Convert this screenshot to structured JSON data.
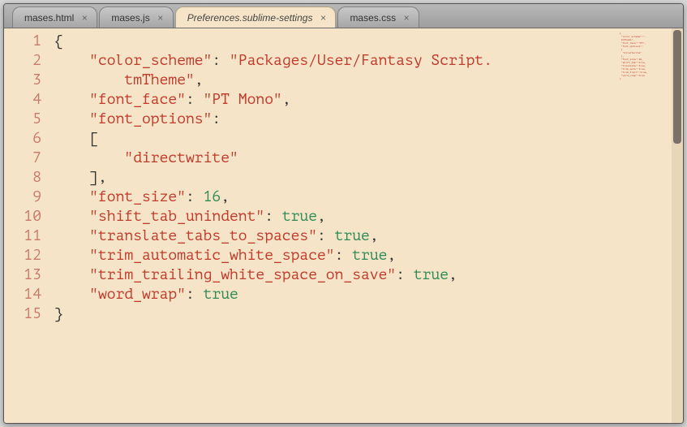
{
  "tabs": [
    {
      "label": "mases.html",
      "active": false
    },
    {
      "label": "mases.js",
      "active": false
    },
    {
      "label": "Preferences.sublime-settings",
      "active": true
    },
    {
      "label": "mases.css",
      "active": false
    }
  ],
  "gutter": {
    "lines": [
      "1",
      "2",
      "",
      "3",
      "4",
      "5",
      "6",
      "7",
      "8",
      "9",
      "10",
      "11",
      "12",
      "13",
      "14",
      "15"
    ]
  },
  "code": {
    "l1_open": "{",
    "l2_key": "\"color_scheme\"",
    "l2_colon": ": ",
    "l2_str_a": "\"Packages/User/Fantasy Script.",
    "l2b_str": "tmTheme\"",
    "l2b_comma": ",",
    "l3_key": "\"font_face\"",
    "l3_colon": ": ",
    "l3_str": "\"PT Mono\"",
    "l3_comma": ",",
    "l4_key": "\"font_options\"",
    "l4_colon": ":",
    "l5_open": "[",
    "l6_str": "\"directwrite\"",
    "l7_close": "],",
    "l8_key": "\"font_size\"",
    "l8_colon": ": ",
    "l8_num": "16",
    "l8_comma": ",",
    "l9_key": "\"shift_tab_unindent\"",
    "l9_colon": ": ",
    "l9_bool": "true",
    "l9_comma": ",",
    "l10_key": "\"translate_tabs_to_spaces\"",
    "l10_colon": ": ",
    "l10_bool": "true",
    "l10_comma": ",",
    "l11_key": "\"trim_automatic_white_space\"",
    "l11_colon": ": ",
    "l11_bool": "true",
    "l11_comma": ",",
    "l12_key": "\"trim_trailing_white_space_on_save\"",
    "l12_colon": ": ",
    "l12_bool": "true",
    "l12_comma": ",",
    "l13_key": "\"word_wrap\"",
    "l13_colon": ": ",
    "l13_bool": "true",
    "l14_close": "}"
  },
  "close_glyph": "×",
  "minimap_text": "{\n \"color_scheme\":\"..\n tmTheme\",\n \"font_face\":\"PT\",\n \"font_options\":\n [\n  \"directwrite\"\n ],\n \"font_size\":16,\n \"shift_tab\":true,\n \"translate\":true,\n \"trim_auto\":true,\n \"trim_trail\":true,\n \"word_wrap\":true\n}"
}
